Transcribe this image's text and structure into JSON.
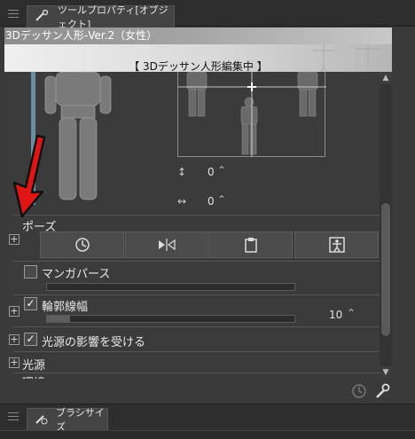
{
  "tool_property_tab": {
    "label": "ツールプロパティ[オブジェクト]"
  },
  "header": {
    "title": "3Dデッサン人形-Ver.2（女性）",
    "status": "【 3Dデッサン人形編集中 】"
  },
  "controls": {
    "vertical_value": "0",
    "horizontal_value": "0"
  },
  "sections": {
    "pose_label": "ポーズ",
    "manga_perspective_label": "マンガパース",
    "outline_width_label": "輪郭線幅",
    "outline_width_value": "10",
    "light_affect_label": "光源の影響を受ける",
    "light_label": "光源",
    "cut_off_label": "環境"
  },
  "brush_size_tab": {
    "label": "ブラシサイズ"
  },
  "colors": {
    "annotation_arrow": "#e01515"
  }
}
